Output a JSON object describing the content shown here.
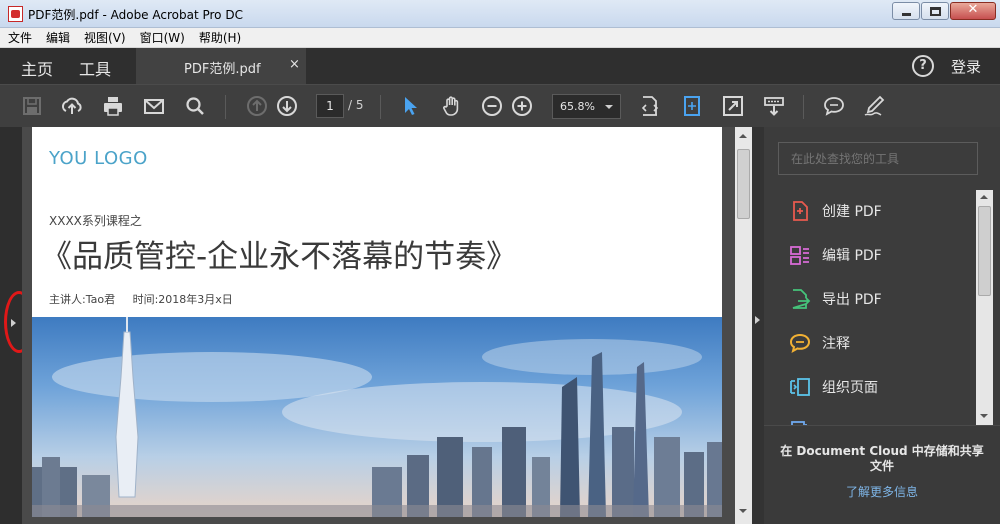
{
  "window": {
    "title": "PDF范例.pdf - Adobe Acrobat Pro DC",
    "close_glyph": "✕"
  },
  "menu": [
    "文件",
    "编辑",
    "视图(V)",
    "窗口(W)",
    "帮助(H)"
  ],
  "tabs": {
    "home": "主页",
    "tools": "工具",
    "doc": "PDF范例.pdf",
    "close": "×",
    "help": "?",
    "login": "登录"
  },
  "toolbar": {
    "icons": [
      "save-icon",
      "upload-icon",
      "print-icon",
      "email-icon",
      "search-icon",
      "prev-page-icon",
      "next-page-icon",
      "select-icon",
      "hand-icon",
      "zoom-out-icon",
      "zoom-in-icon",
      "page-fit-icon",
      "rotate-icon",
      "fullscreen-icon",
      "read-mode-icon",
      "comment-icon",
      "sign-icon"
    ],
    "page_current": "1",
    "page_total": "/ 5",
    "zoom": "65.8%"
  },
  "document": {
    "logo": "YOU LOGO",
    "series": "XXXX系列课程之",
    "title": "《品质管控-企业永不落幕的节奏》",
    "speaker": "主讲人:Tao君",
    "time": "时间:2018年3月x日"
  },
  "right_pane": {
    "search_placeholder": "在此处查找您的工具",
    "tools": [
      {
        "label": "创建 PDF",
        "icon": "create-pdf-icon",
        "color": "#e85a4f"
      },
      {
        "label": "编辑 PDF",
        "icon": "edit-pdf-icon",
        "color": "#d86bd6"
      },
      {
        "label": "导出 PDF",
        "icon": "export-pdf-icon",
        "color": "#45c37a"
      },
      {
        "label": "注释",
        "icon": "comment-tool-icon",
        "color": "#f2b134"
      },
      {
        "label": "组织页面",
        "icon": "organize-pages-icon",
        "color": "#5cc3ea"
      },
      {
        "label": "",
        "icon": "more-tool-icon",
        "color": "#6fa9ef"
      }
    ],
    "cloud_text": "在 Document Cloud 中存储和共享文件",
    "learn_more": "了解更多信息"
  },
  "colors": {
    "accent": "#4ba3c9",
    "highlight": "#e01818",
    "toolbar_bg": "#3f3f3f",
    "select_tool": "#4aa3f0"
  }
}
